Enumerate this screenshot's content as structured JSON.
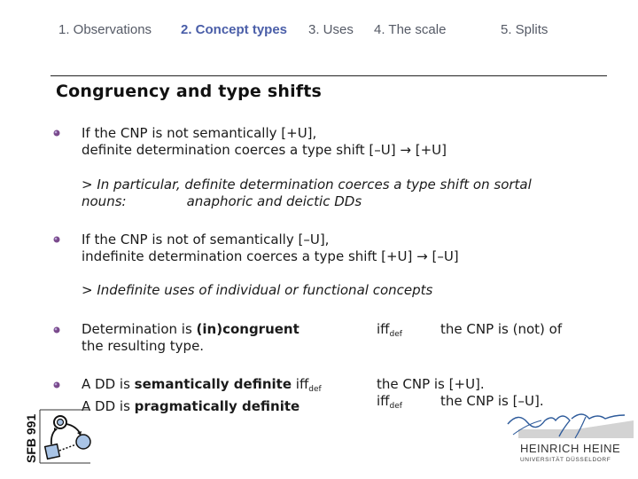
{
  "nav": {
    "items": [
      {
        "label": "1. Observations",
        "active": false
      },
      {
        "label": "2. Concept types",
        "active": true
      },
      {
        "label": "3. Uses",
        "active": false
      },
      {
        "label": "4. The scale",
        "active": false
      },
      {
        "label": "5. Splits",
        "active": false
      }
    ]
  },
  "slide": {
    "title": "Congruency and type shifts",
    "bullet1": {
      "line1": "If the CNP is not semantically [+U],",
      "line2": "definite determination coerces a type shift [–U] → [+U]"
    },
    "note1": {
      "line1": "> In particular, definite determination coerces a type shift on sortal",
      "line2_a": "nouns:",
      "line2_b": "anaphoric and deictic DDs"
    },
    "bullet2": {
      "line1": "If the CNP is not of semantically [–U],",
      "line2": "indefinite determination coerces a type shift [+U] → [–U]"
    },
    "note2": "> Indefinite uses of individual or functional concepts",
    "bullet3": {
      "pre": "Determination is ",
      "bold_in": "(in)",
      "bold_word": "congruent",
      "line2": "the resulting type.",
      "iff": "iff",
      "iff_sub": "def",
      "rhs": "the CNP is (not) of"
    },
    "bullet4": {
      "line1_pre": "A DD is ",
      "line1_bold": "semantically definite",
      "line1_iff": "iff",
      "line1_iff_sub": "def",
      "line1_rhs": "the CNP is [+U].",
      "line2_pre": "A DD is ",
      "line2_bold": "pragmatically definite",
      "line2_iff": "iff",
      "line2_iff_sub": "def",
      "line2_rhs": "the CNP is [–U]."
    }
  },
  "logos": {
    "sfb": {
      "label": "SFB 991"
    },
    "hhu": {
      "line1": "HEINRICH HEINE",
      "line2": "UNIVERSITÄT DÜSSELDORF"
    }
  },
  "colors": {
    "nav_active": "#4a5ea8",
    "nav_inactive": "#555a66",
    "bullet": "#7a4a8c"
  }
}
